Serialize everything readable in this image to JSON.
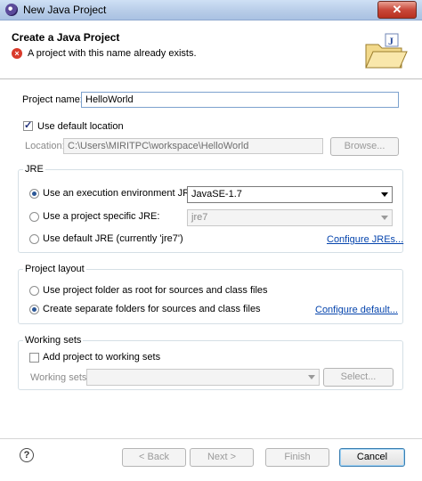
{
  "window": {
    "title": "New Java Project",
    "close_glyph": "✕"
  },
  "header": {
    "heading": "Create a Java Project",
    "error_icon": "×",
    "error_message": "A project with this name already exists."
  },
  "project_name": {
    "label": "Project name:",
    "value": "HelloWorld"
  },
  "location": {
    "use_default_label": "Use default location",
    "use_default_checked": true,
    "label": "Location:",
    "value": "C:\\Users\\MIRITPC\\workspace\\HelloWorld",
    "browse_label": "Browse..."
  },
  "jre": {
    "group_title": "JRE",
    "options": [
      {
        "label": "Use an execution environment JRE:",
        "selected": true
      },
      {
        "label": "Use a project specific JRE:",
        "selected": false
      },
      {
        "label": "Use default JRE (currently 'jre7')",
        "selected": false
      }
    ],
    "execution_env_value": "JavaSE-1.7",
    "project_specific_value": "jre7",
    "configure_link": "Configure JREs..."
  },
  "project_layout": {
    "group_title": "Project layout",
    "options": [
      {
        "label": "Use project folder as root for sources and class files",
        "selected": false
      },
      {
        "label": "Create separate folders for sources and class files",
        "selected": true
      }
    ],
    "configure_link": "Configure default..."
  },
  "working_sets": {
    "group_title": "Working sets",
    "add_label": "Add project to working sets",
    "add_checked": false,
    "label": "Working sets:",
    "value": "",
    "select_label": "Select..."
  },
  "footer": {
    "help_glyph": "?",
    "back_label": "< Back",
    "next_label": "Next >",
    "finish_label": "Finish",
    "cancel_label": "Cancel"
  }
}
